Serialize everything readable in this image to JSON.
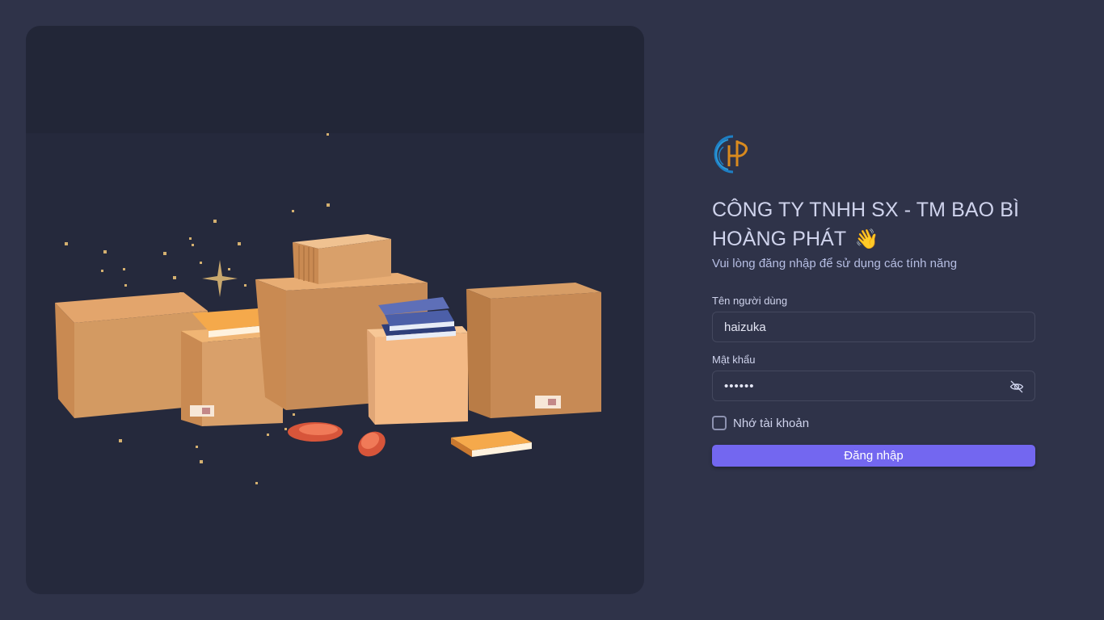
{
  "brand": {
    "logo_icon": "hoang-phat-logo-icon",
    "title": "CÔNG TY TNHH SX - TM BAO BÌ HOÀNG PHÁT",
    "wave": "👋",
    "subtitle": "Vui lòng đăng nhập để sử dụng các tính năng"
  },
  "form": {
    "username_label": "Tên người dùng",
    "username_value": "haizuka",
    "password_label": "Mật khẩu",
    "password_value": "••••••",
    "password_toggle_icon": "eye-off-icon",
    "remember_label": "Nhớ tài khoản",
    "remember_checked": false,
    "submit_label": "Đăng nhập"
  },
  "colors": {
    "background": "#2f3349",
    "panel": "#25293c",
    "accent": "#7367f0",
    "input_border": "#44485e"
  }
}
